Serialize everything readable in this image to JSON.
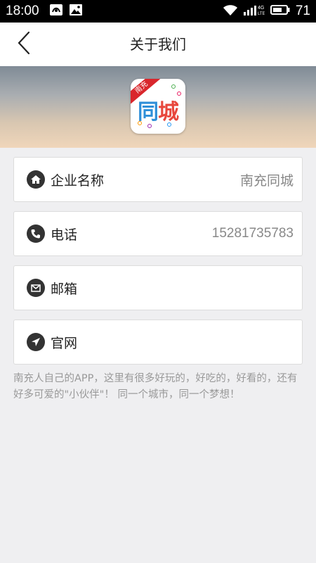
{
  "status_bar": {
    "time": "18:00",
    "network": "4G LTE",
    "battery": "71",
    "icons": [
      "notification-app-icon",
      "gallery-icon",
      "wifi-icon",
      "signal-icon",
      "battery-icon"
    ]
  },
  "nav": {
    "title": "关于我们",
    "back_icon": "chevron-left-icon"
  },
  "banner": {
    "logo_ribbon": "南充",
    "logo_text_a": "同",
    "logo_text_b": "城"
  },
  "info_items": [
    {
      "icon": "home-icon",
      "label": "企业名称",
      "value": "南充同城"
    },
    {
      "icon": "phone-icon",
      "label": "电话",
      "value": "15281735783"
    },
    {
      "icon": "mail-icon",
      "label": "邮箱",
      "value": ""
    },
    {
      "icon": "navigation-icon",
      "label": "官网",
      "value": ""
    }
  ],
  "intro_text": "南充人自己的APP，这里有很多好玩的，好吃的，好看的，还有好多可爱的\"小伙伴\"！ 同一个城市，同一个梦想！",
  "colors": {
    "accent_red": "#d9262c",
    "accent_blue": "#2f8fd8",
    "icon_dark": "#333333",
    "background": "#efeff1"
  }
}
